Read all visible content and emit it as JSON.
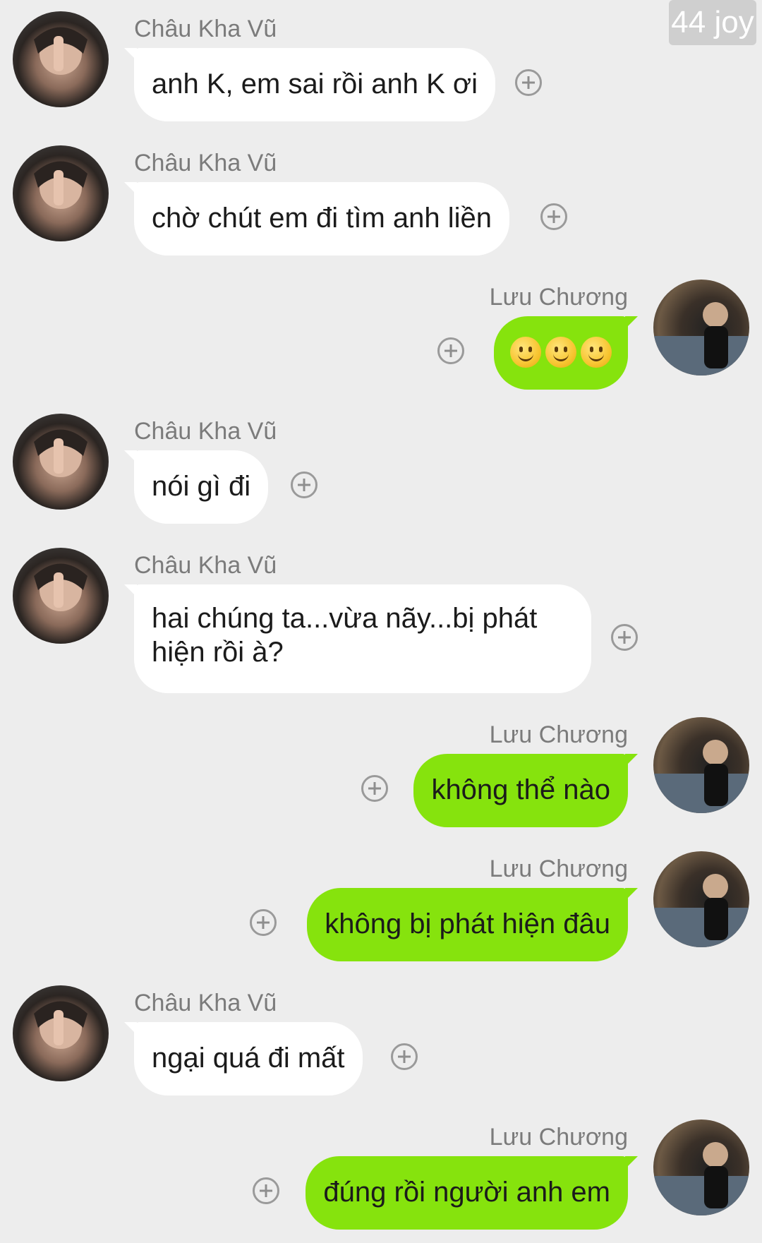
{
  "watermark": "44 joy",
  "messages": [
    {
      "side": "left",
      "sender": "Châu Kha Vũ",
      "text": "anh K, em sai rồi anh K ơi"
    },
    {
      "side": "left",
      "sender": "Châu Kha Vũ",
      "text": "chờ chút em đi tìm anh liền"
    },
    {
      "side": "right",
      "sender": "Lưu Chương",
      "text": "",
      "emojis": [
        "slightly-smiling-face",
        "slightly-smiling-face",
        "slightly-smiling-face"
      ]
    },
    {
      "side": "left",
      "sender": "Châu Kha Vũ",
      "text": "nói gì đi"
    },
    {
      "side": "left",
      "sender": "Châu Kha Vũ",
      "text": "hai chúng ta...vừa nãy...bị phát hiện rồi à?"
    },
    {
      "side": "right",
      "sender": "Lưu Chương",
      "text": "không thể nào"
    },
    {
      "side": "right",
      "sender": "Lưu Chương",
      "text": "không bị phát hiện đâu"
    },
    {
      "side": "left",
      "sender": "Châu Kha Vũ",
      "text": "ngại quá đi mất"
    },
    {
      "side": "right",
      "sender": "Lưu Chương",
      "text": "đúng rồi người anh em"
    }
  ],
  "colors": {
    "background": "#ededed",
    "incoming_bubble": "#ffffff",
    "outgoing_bubble": "#86e30d"
  }
}
